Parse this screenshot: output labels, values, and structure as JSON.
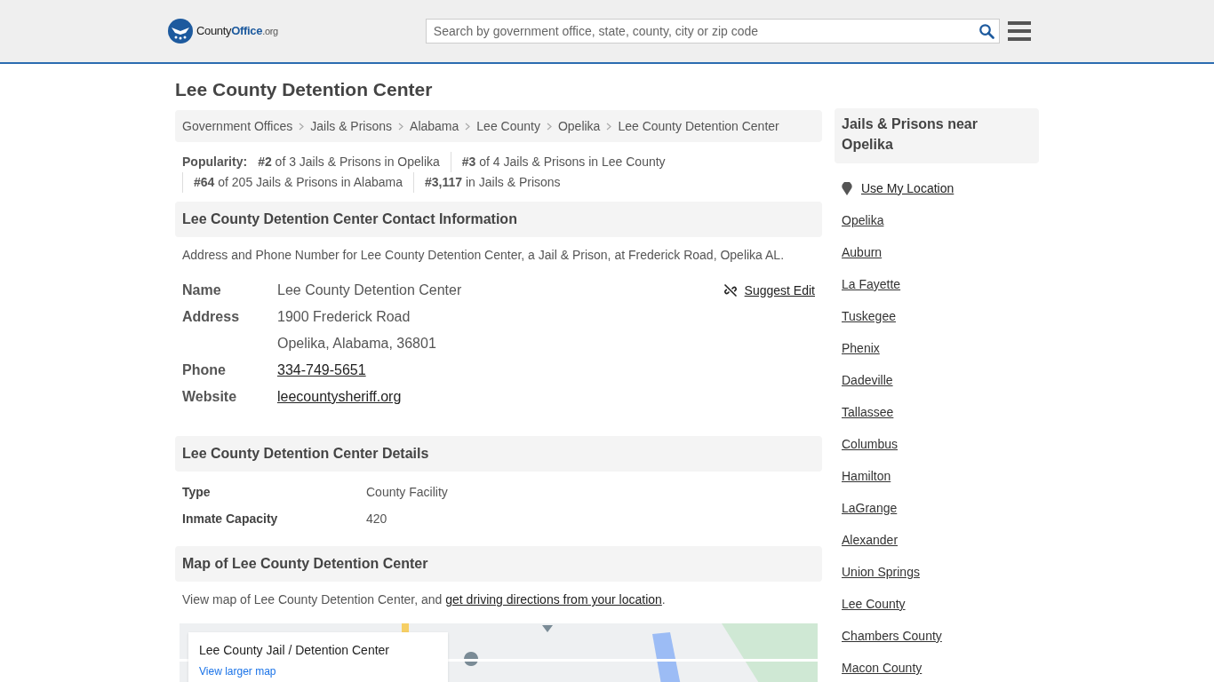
{
  "header": {
    "logo": {
      "part_1": "County",
      "part_2": "Office",
      "part_3": ".org"
    },
    "search": {
      "placeholder": "Search by government office, state, county, city or zip code"
    }
  },
  "title": "Lee County Detention Center",
  "breadcrumbs": [
    "Government Offices",
    "Jails & Prisons",
    "Alabama",
    "Lee County",
    "Opelika",
    "Lee County Detention Center"
  ],
  "popularity": {
    "label": "Popularity:",
    "items": [
      "**#2** of 3 Jails & Prisons in Opelika",
      "**#3** of 4 Jails & Prisons in Lee County",
      "**#64** of 205 Jails & Prisons in Alabama",
      "**#3,117** in Jails & Prisons"
    ]
  },
  "contact": {
    "heading": "Lee County Detention Center Contact Information",
    "intro": "Address and Phone Number for Lee County Detention Center, a Jail & Prison, at Frederick Road, Opelika AL.",
    "suggest_edit": "Suggest Edit",
    "rows": [
      {
        "label": "Name",
        "kind": "text",
        "values": [
          "Lee County Detention Center"
        ]
      },
      {
        "label": "Address",
        "kind": "text",
        "values": [
          "1900 Frederick Road",
          "Opelika, Alabama, 36801"
        ]
      },
      {
        "label": "Phone",
        "kind": "link",
        "values": [
          "334-749-5651"
        ]
      },
      {
        "label": "Website",
        "kind": "link",
        "values": [
          "leecountysheriff.org"
        ]
      }
    ]
  },
  "details": {
    "heading": "Lee County Detention Center Details",
    "rows": [
      {
        "label": "Type",
        "value": "County Facility"
      },
      {
        "label": "Inmate Capacity",
        "value": "420"
      }
    ]
  },
  "map": {
    "heading": "Map of Lee County Detention Center",
    "intro": "View map of Lee County Detention Center, and ",
    "directions_link": "get driving directions from your location",
    "intro_end": ".",
    "card": {
      "title": "Lee County Jail / Detention Center",
      "link": "View larger map"
    }
  },
  "sidebar": {
    "heading": "Jails & Prisons near Opelika",
    "location_link": "Use My Location",
    "links": [
      "Opelika",
      "Auburn",
      "La Fayette",
      "Tuskegee",
      "Phenix",
      "Dadeville",
      "Tallassee",
      "Columbus",
      "Hamilton",
      "LaGrange",
      "Alexander",
      "Union Springs",
      "Lee County",
      "Chambers County",
      "Macon County"
    ]
  }
}
